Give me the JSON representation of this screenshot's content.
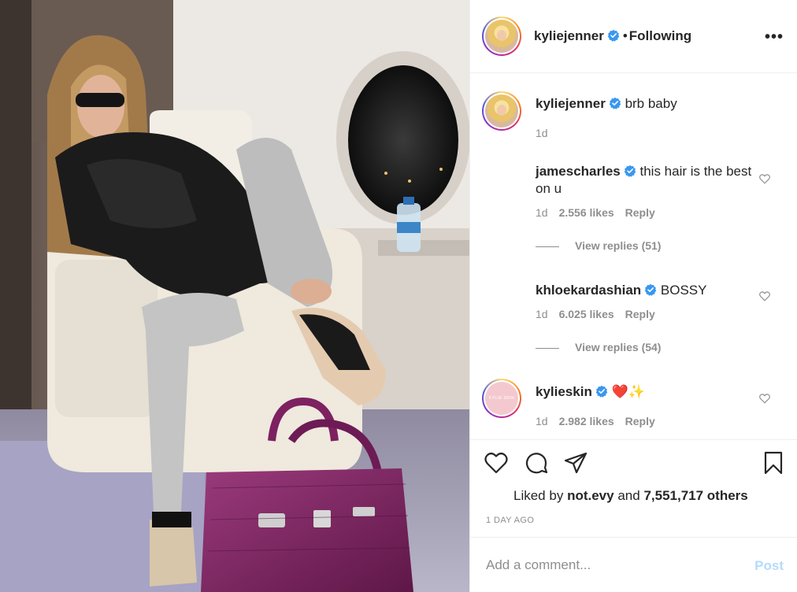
{
  "post": {
    "author": "kyliejenner",
    "follow_status": "Following",
    "separator": "•",
    "caption": "brb baby",
    "caption_time": "1d"
  },
  "comments": [
    {
      "user": "jamescharles",
      "text": "this hair is the best on u",
      "time": "1d",
      "likes": "2.556 likes",
      "reply": "Reply",
      "view_replies": "View replies (51)"
    },
    {
      "user": "khloekardashian",
      "text": "BOSSY",
      "time": "1d",
      "likes": "6.025 likes",
      "reply": "Reply",
      "view_replies": "View replies (54)"
    },
    {
      "user": "kylieskin",
      "text": "❤️✨",
      "time": "1d",
      "likes": "2.982 likes",
      "reply": "Reply"
    }
  ],
  "likes": {
    "prefix": "Liked by",
    "first_user": "not.evy",
    "joiner": "and",
    "count_text": "7,551,717 others"
  },
  "post_age": "1 DAY AGO",
  "add_comment": {
    "placeholder": "Add a comment...",
    "post_label": "Post"
  },
  "colors": {
    "verified": "#3897f0",
    "post_disabled": "#b3dbff",
    "muted": "#8e8e8e",
    "bag": "#8a2a6a"
  }
}
